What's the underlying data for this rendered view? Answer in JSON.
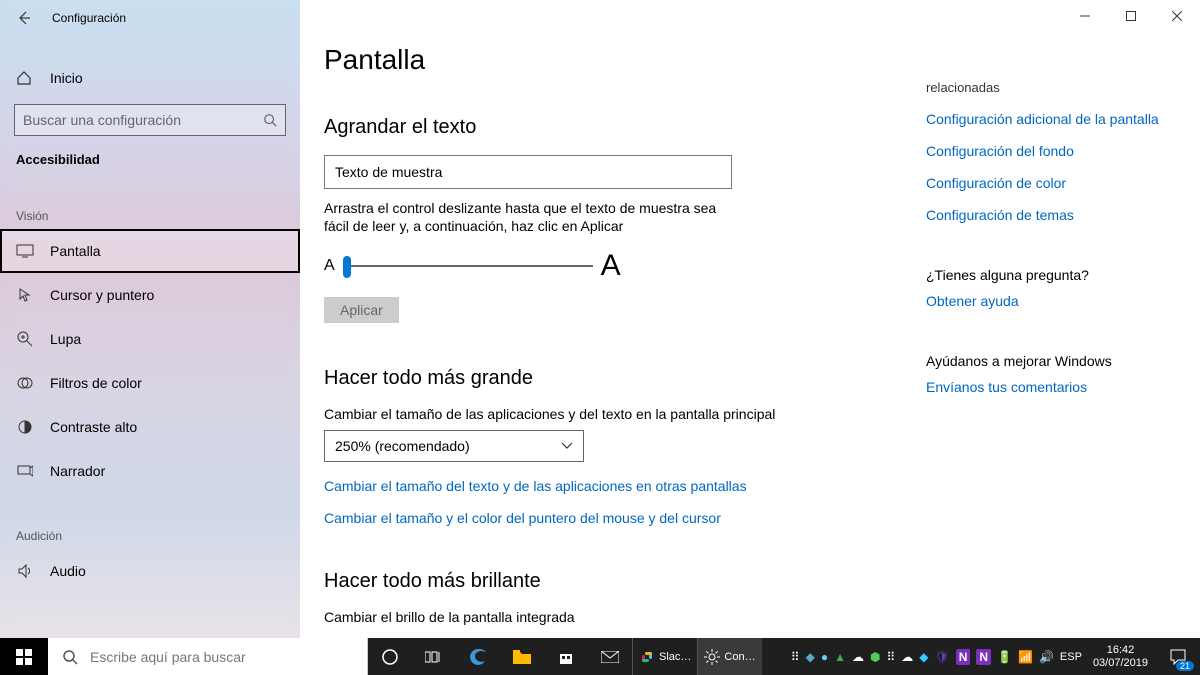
{
  "window": {
    "title": "Configuración",
    "home_label": "Inicio",
    "search_placeholder": "Buscar una configuración",
    "accessibility_label": "Accesibilidad"
  },
  "sidebar": {
    "groups": [
      {
        "label": "Visión",
        "items": [
          {
            "label": "Pantalla",
            "selected": true
          },
          {
            "label": "Cursor y puntero"
          },
          {
            "label": "Lupa"
          },
          {
            "label": "Filtros de color"
          },
          {
            "label": "Contraste alto"
          },
          {
            "label": "Narrador"
          }
        ]
      },
      {
        "label": "Audición",
        "items": [
          {
            "label": "Audio"
          }
        ]
      }
    ]
  },
  "page": {
    "title": "Pantalla",
    "enlarge_text": {
      "heading": "Agrandar el texto",
      "sample": "Texto de muestra",
      "hint": "Arrastra el control deslizante hasta que el texto de muestra sea fácil de leer y, a continuación, haz clic en Aplicar",
      "apply": "Aplicar"
    },
    "make_bigger": {
      "heading": "Hacer todo más grande",
      "label": "Cambiar el tamaño de las aplicaciones y del texto en la pantalla principal",
      "value": "250% (recomendado)",
      "link1": "Cambiar el tamaño del texto y de las aplicaciones en otras pantallas",
      "link2": "Cambiar el tamaño y el color del puntero del mouse y del cursor"
    },
    "brighter": {
      "heading": "Hacer todo más brillante",
      "label": "Cambiar el brillo de la pantalla integrada"
    }
  },
  "right": {
    "related_head": "relacionadas",
    "links": [
      "Configuración adicional de la pantalla",
      "Configuración del fondo",
      "Configuración de color",
      "Configuración de temas"
    ],
    "question": "¿Tienes alguna pregunta?",
    "help": "Obtener ayuda",
    "improve": "Ayúdanos a mejorar Windows",
    "feedback": "Envíanos tus comentarios"
  },
  "taskbar": {
    "search": "Escribe aquí para buscar",
    "apps": [
      {
        "label": "Slac…"
      },
      {
        "label": "Con…"
      }
    ],
    "time": "16:42",
    "date": "03/07/2019",
    "badge": "21"
  }
}
